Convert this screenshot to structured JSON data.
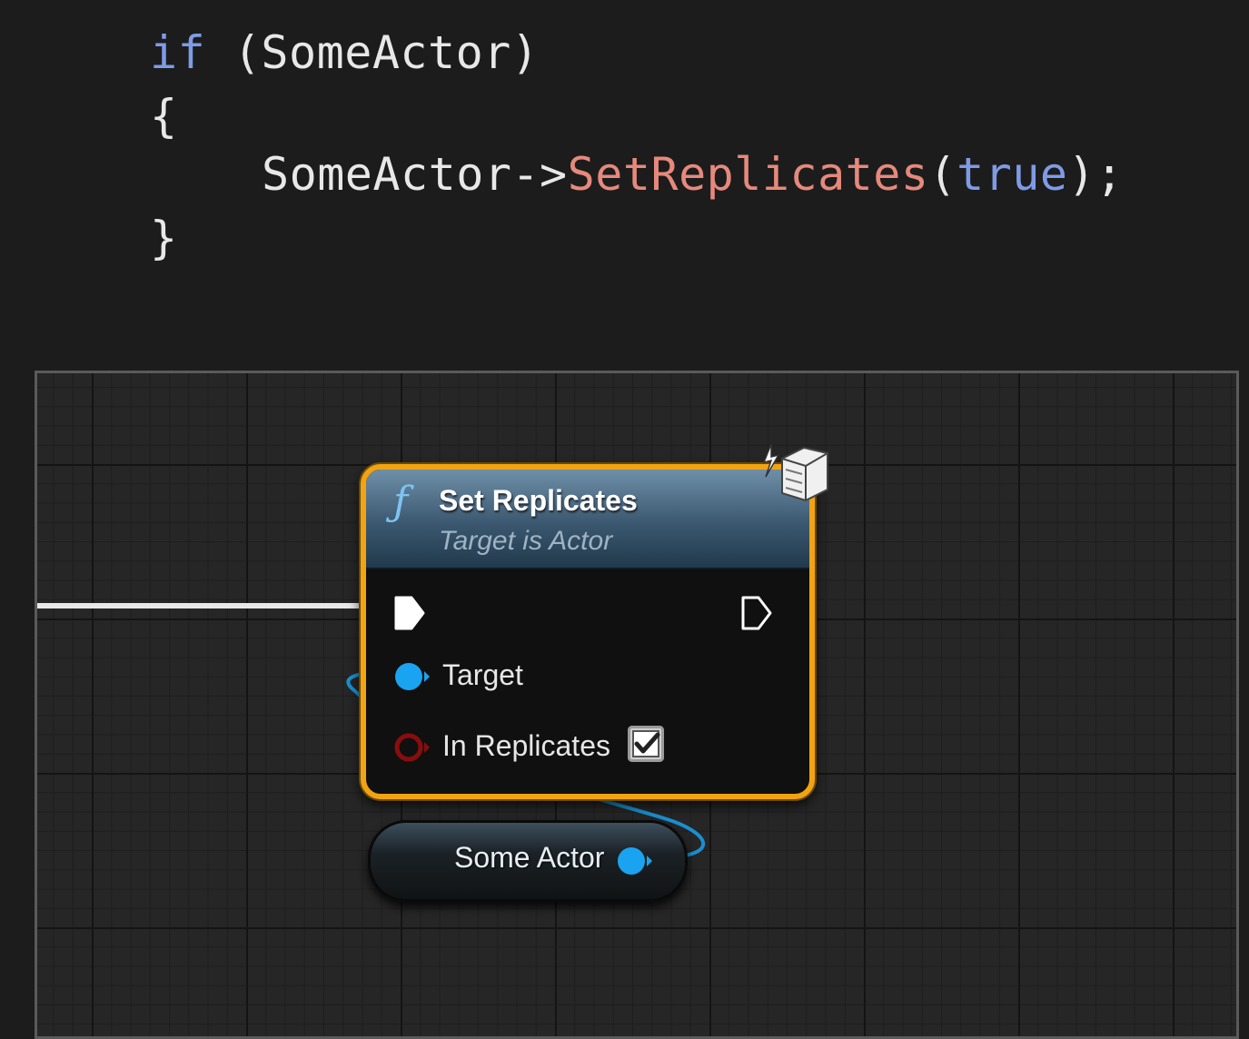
{
  "code": {
    "line1": {
      "keyword": "if",
      "rest": " (SomeActor)"
    },
    "line2": "{",
    "line3": {
      "object": "SomeActor",
      "arrow": "->",
      "method": "SetReplicates",
      "open": "(",
      "arg": "true",
      "close": ");"
    },
    "line4": "}"
  },
  "colors": {
    "keyword": "#7f9be6",
    "method": "#e6897c",
    "text": "#e8e8e8",
    "node_border": "#f2a312",
    "pin_object": "#1aa3f0",
    "pin_bool": "#8a0d0d"
  },
  "blueprint": {
    "function_node": {
      "icon": "function-icon",
      "title": "Set Replicates",
      "subtitle": "Target is Actor",
      "pins": {
        "target": "Target",
        "in_replicates": "In Replicates"
      },
      "in_replicates_checked": true
    },
    "variable_node": {
      "label": "Some Actor"
    }
  }
}
